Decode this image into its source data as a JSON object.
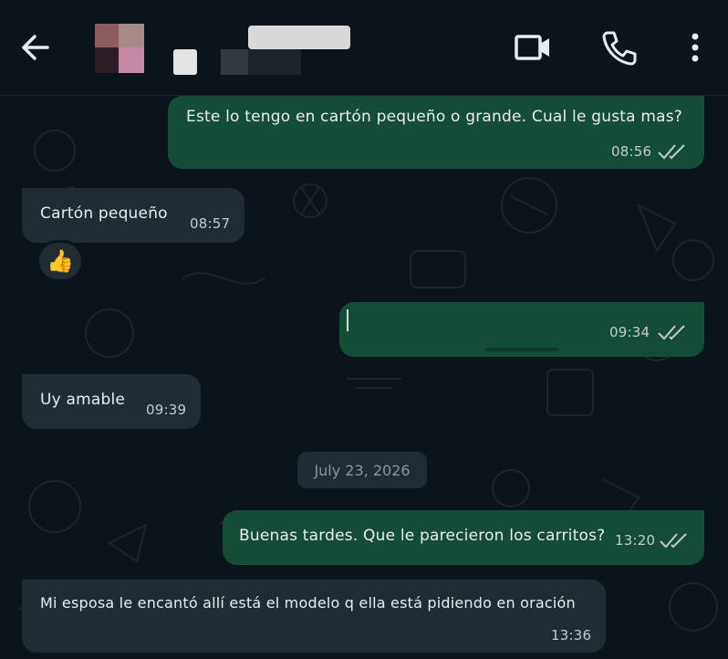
{
  "header": {
    "back_icon": "arrow-left-icon",
    "video_icon": "video-camera-icon",
    "call_icon": "phone-icon",
    "menu_icon": "more-vertical-icon"
  },
  "messages": [
    {
      "direction": "out",
      "text": "Este lo tengo en cartón pequeño o grande. Cual le gusta mas?",
      "time": "08:56",
      "status": "read"
    },
    {
      "direction": "in",
      "text": "Cartón pequeño",
      "time": "08:57",
      "reaction": "👍"
    },
    {
      "direction": "out",
      "text": "",
      "time": "09:34",
      "status": "read"
    },
    {
      "direction": "in",
      "text": "Uy amable",
      "time": "09:39"
    },
    {
      "direction": "out",
      "text": "Buenas tardes.  Que le parecieron los carritos?",
      "time": "13:20",
      "status": "read"
    },
    {
      "direction": "in",
      "text": "Mi esposa le encantó allí está el modelo q ella está pidiendo en oración",
      "time": "13:36"
    }
  ],
  "date_separator": "July 23, 2026",
  "colors": {
    "background": "#0b141a",
    "outgoing": "#144d37",
    "incoming": "#1f2c34",
    "tick": "#c4cbd0"
  }
}
